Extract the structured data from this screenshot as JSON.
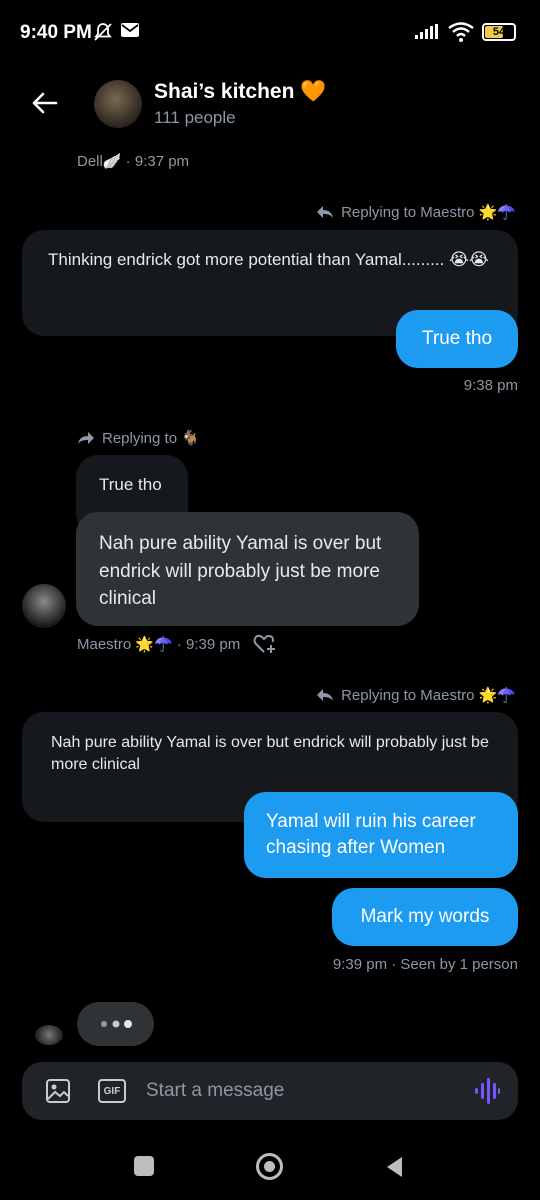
{
  "status_bar": {
    "time": "9:40 PM",
    "battery": "54"
  },
  "header": {
    "title": "Shai’s kitchen 🧡",
    "subtitle": "111 people"
  },
  "messages": {
    "m0_meta": "Dell🪽 · 9:37 pm",
    "m1_reply_label": "Replying to Maestro 🌟☂️",
    "m1_quote": "Thinking endrick got more potential than Yamal......... 😭😭",
    "m1_text": "True tho",
    "m1_time": "9:38 pm",
    "m2_reply_label": "Replying to 🐐",
    "m2_quote": "True tho",
    "m2_text": "Nah pure ability Yamal is over but endrick will probably just be more clinical",
    "m2_meta": "Maestro 🌟☂️ · 9:39 pm",
    "m3_reply_label": "Replying to Maestro 🌟☂️",
    "m3_quote": "Nah pure ability Yamal is over but endrick will probably just be more clinical",
    "m3_text1": "Yamal will ruin his career chasing after Women",
    "m3_text2": "Mark my words",
    "m3_meta": "9:39 pm · Seen by 1 person"
  },
  "composer": {
    "placeholder": "Start a message",
    "gif_label": "GIF"
  },
  "icons": [
    "back-arrow-icon",
    "reply-icon",
    "forward-reply-icon",
    "heart-plus-icon",
    "image-icon",
    "gif-icon",
    "voice-icon",
    "typing-dots-icon"
  ],
  "colors": {
    "accent": "#1d9bf0",
    "voice": "#7856ff",
    "background": "#000000"
  }
}
